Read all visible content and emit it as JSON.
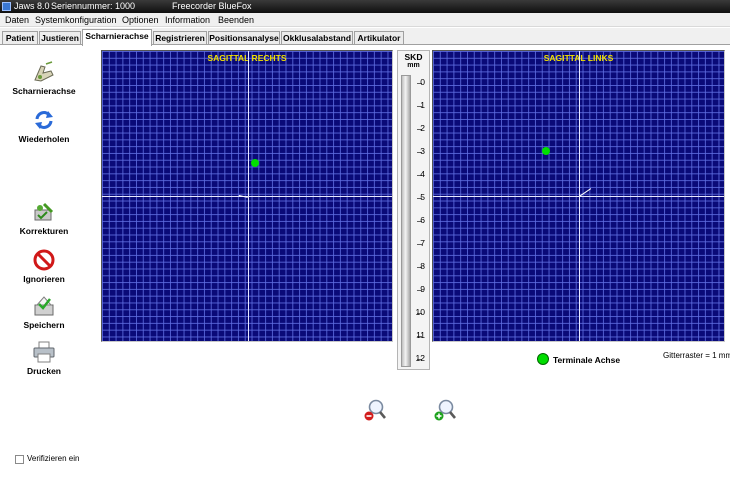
{
  "window": {
    "app": "Jaws 8.0",
    "serial": "Seriennummer: 1000",
    "device": "Freecorder BlueFox"
  },
  "menu": [
    "Daten",
    "Systemkonfiguration",
    "Optionen",
    "Information",
    "Beenden"
  ],
  "tabs": [
    {
      "label": "Patient",
      "active": false
    },
    {
      "label": "Justieren",
      "active": false
    },
    {
      "label": "Scharnierachse",
      "active": true
    },
    {
      "label": "Registrieren",
      "active": false
    },
    {
      "label": "Positionsanalyse",
      "active": false
    },
    {
      "label": "Okklusalabstand",
      "active": false
    },
    {
      "label": "Artikulator",
      "active": false
    }
  ],
  "tools": {
    "scharnierachse": {
      "label": "Scharnierachse",
      "icon": "hinge-axis-icon"
    },
    "wiederholen": {
      "label": "Wiederholen",
      "icon": "repeat-icon"
    },
    "korrekturen": {
      "label": "Korrekturen",
      "icon": "correction-icon"
    },
    "ignorieren": {
      "label": "Ignorieren",
      "icon": "ignore-icon"
    },
    "speichern": {
      "label": "Speichern",
      "icon": "save-icon"
    },
    "drucken": {
      "label": "Drucken",
      "icon": "printer-icon"
    }
  },
  "panels": {
    "right": {
      "title": "SAGITTAL RECHTS"
    },
    "left": {
      "title": "SAGITTAL LINKS"
    }
  },
  "ruler": {
    "header": "SKD",
    "unit": "mm",
    "ticks": [
      "0",
      "1",
      "2",
      "3",
      "4",
      "5",
      "6",
      "7",
      "8",
      "9",
      "10",
      "11",
      "12"
    ]
  },
  "legend": {
    "label": "Terminale Achse",
    "color": "#00dd00"
  },
  "grid_note": "Gitterraster = 1 mm",
  "verify": {
    "label": "Verifizieren ein",
    "checked": false
  },
  "colors": {
    "grid_bg": "#0a0a78",
    "grid_line": "#5f6ee1",
    "title": "#f0e000",
    "point": "#00e000"
  }
}
